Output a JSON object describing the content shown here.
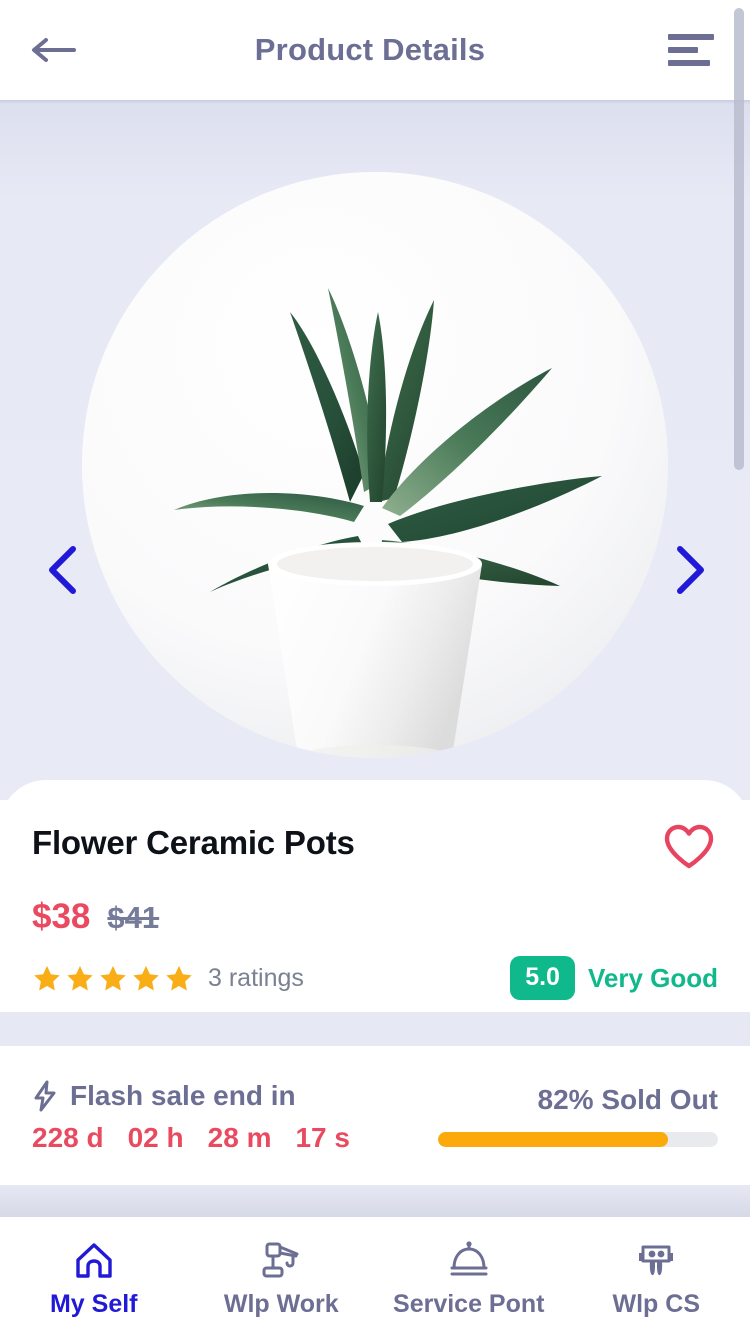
{
  "header": {
    "title": "Product Details",
    "back_icon": "arrow-left-icon",
    "menu_icon": "hamburger-menu-icon"
  },
  "gallery": {
    "prev_icon": "chevron-left-icon",
    "next_icon": "chevron-right-icon",
    "image_alt": "potted succulent plant in white ceramic pot"
  },
  "product": {
    "title": "Flower Ceramic Pots",
    "price_current": "$38",
    "price_original": "$41",
    "favorite_icon": "heart-outline-icon",
    "stars": 5,
    "ratings_text": "3 ratings",
    "score": "5.0",
    "score_label": "Very Good",
    "score_color": "#10b98b",
    "price_color": "#ea4a5f",
    "star_color": "#f9ae17"
  },
  "flash_sale": {
    "icon": "lightning-bolt-icon",
    "heading": "Flash sale end in",
    "days": "228 d",
    "hours": "02 h",
    "minutes": "28 m",
    "seconds": "17 s",
    "sold_out_text": "82% Sold Out",
    "sold_percent": 82,
    "progress_color": "#fba90b"
  },
  "bottom_nav": {
    "items": [
      {
        "label": "My Self",
        "icon": "home-icon",
        "active": true
      },
      {
        "label": "Wlp Work",
        "icon": "crane-icon",
        "active": false
      },
      {
        "label": "Service Pont",
        "icon": "service-bell-icon",
        "active": false
      },
      {
        "label": "Wlp CS",
        "icon": "customer-support-icon",
        "active": false
      }
    ],
    "active_color": "#2118d8",
    "inactive_color": "#6c6f93"
  }
}
